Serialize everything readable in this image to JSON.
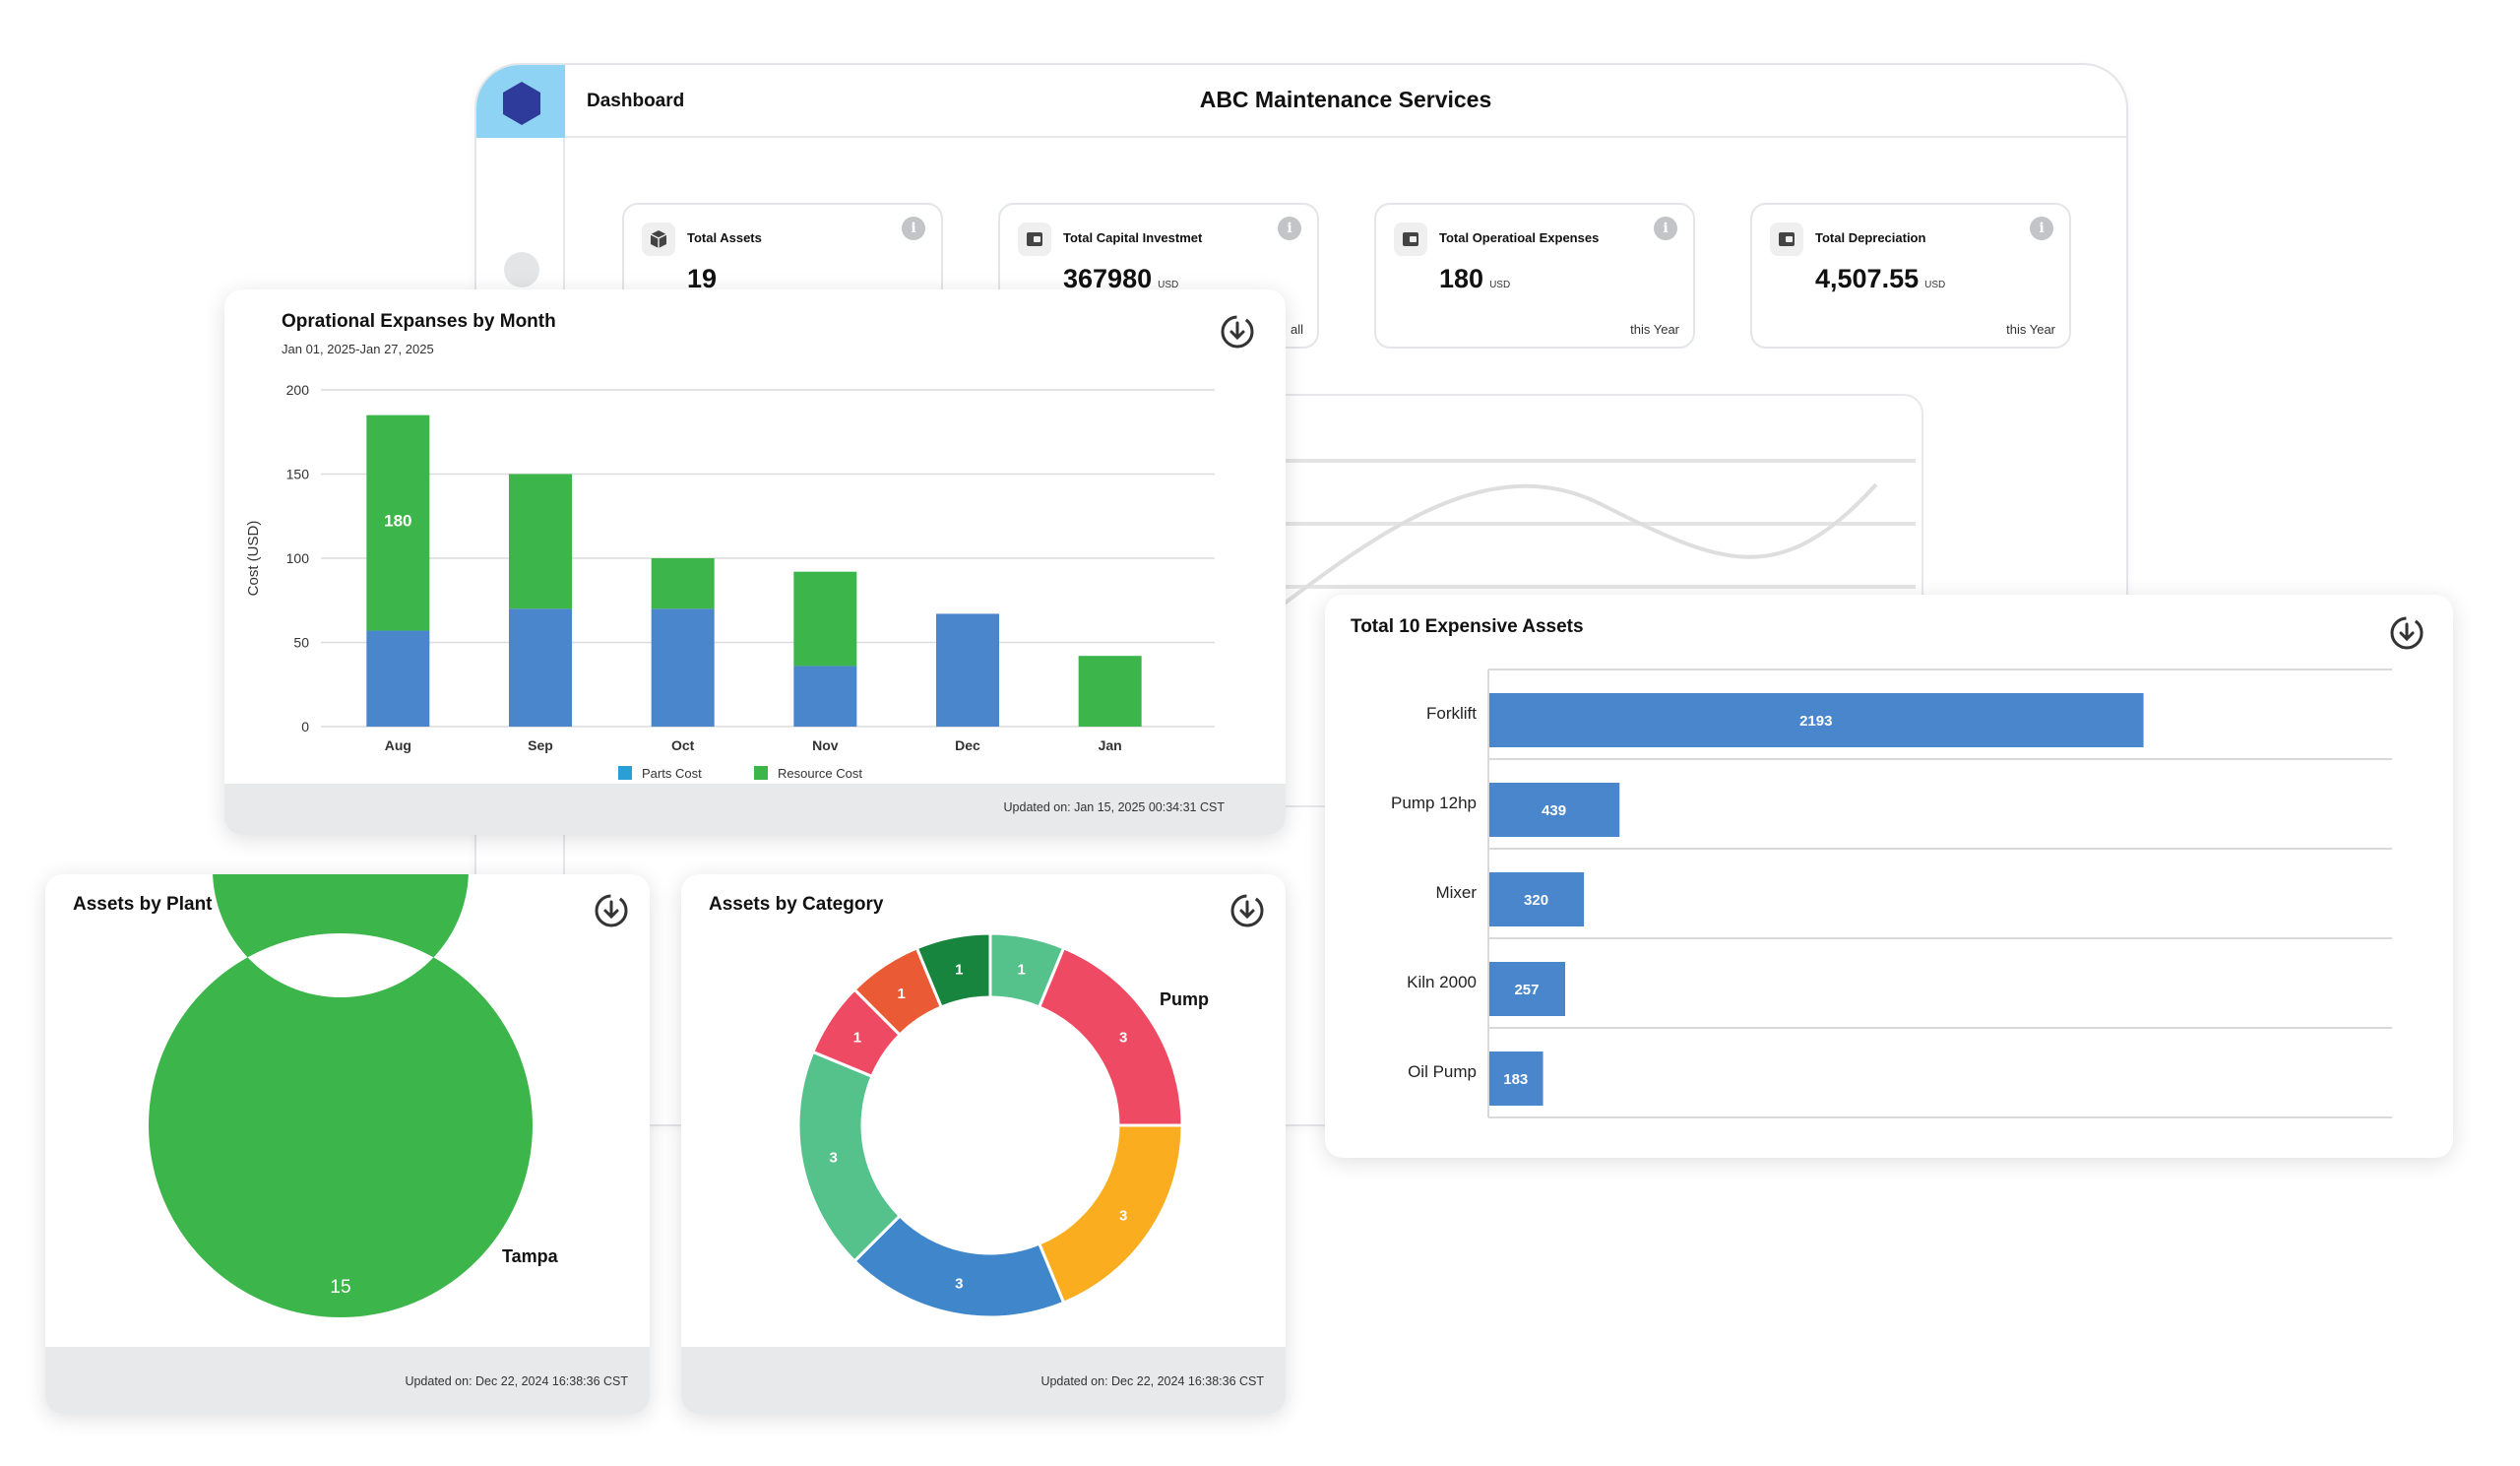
{
  "window": {
    "section": "Dashboard",
    "title": "ABC Maintenance Services",
    "logo_icon": "hexagon-logo-icon",
    "accent_color": "#8ed3f3"
  },
  "stats": [
    {
      "label": "Total Assets",
      "value": "19",
      "unit": "",
      "foot": "",
      "icon": "box-icon"
    },
    {
      "label": "Total Capital Investmet",
      "value": "367980",
      "unit": "USD",
      "foot": "all",
      "icon": "wallet-icon"
    },
    {
      "label": "Total Operatioal Expenses",
      "value": "180",
      "unit": "USD",
      "foot": "this Year",
      "icon": "wallet-icon"
    },
    {
      "label": "Total Depreciation",
      "value": "4,507.55",
      "unit": "USD",
      "foot": "this Year",
      "icon": "wallet-icon"
    }
  ],
  "opex_card": {
    "title": "Oprational Expanses by Month",
    "date_range": "Jan 01, 2025-Jan 27, 2025",
    "updated": "Updated on: Jan 15, 2025 00:34:31 CST"
  },
  "expensive_card": {
    "title": "Total 10 Expensive Assets"
  },
  "plant_card": {
    "title": "Assets by Plant or Facility",
    "updated": "Updated on: Dec 22, 2024 16:38:36 CST"
  },
  "category_card": {
    "title": "Assets by Category",
    "updated": "Updated on: Dec 22, 2024 16:38:36 CST"
  },
  "chart_data": [
    {
      "type": "bar",
      "stacked": true,
      "categories": [
        "Aug",
        "Sep",
        "Oct",
        "Nov",
        "Dec",
        "Jan"
      ],
      "series": [
        {
          "name": "Parts Cost",
          "values": [
            57,
            70,
            70,
            36,
            67,
            0
          ],
          "color": "#4a86cc",
          "legend_color": "#2a9fd6"
        },
        {
          "name": "Resource Cost",
          "values": [
            128,
            80,
            30,
            56,
            0,
            42
          ],
          "color": "#3cb54a"
        }
      ],
      "data_labels": [
        {
          "category": "Aug",
          "text": "180"
        }
      ],
      "ylabel": "Cost (USD)",
      "ylim": [
        0,
        200
      ],
      "yticks": [
        0,
        50,
        100,
        150,
        200
      ],
      "grid": true,
      "legend": "bottom"
    },
    {
      "type": "bar",
      "orientation": "horizontal",
      "categories": [
        "Forklift",
        "Pump 12hp",
        "Mixer",
        "Kiln 2000",
        "Oil Pump"
      ],
      "values": [
        2193,
        439,
        320,
        257,
        183
      ],
      "color": "#4a86cc",
      "grid": true
    },
    {
      "type": "pie",
      "donut": true,
      "slices": [
        {
          "label": "Tampa",
          "value": 15,
          "color": "#3cb54a"
        }
      ]
    },
    {
      "type": "pie",
      "donut": true,
      "slices": [
        {
          "label": "",
          "value": 1,
          "color": "#55c28c"
        },
        {
          "label": "Pump",
          "value": 3,
          "color": "#ef4a63"
        },
        {
          "label": "",
          "value": 3,
          "color": "#fbad20"
        },
        {
          "label": "",
          "value": 3,
          "color": "#3f86cb"
        },
        {
          "label": "",
          "value": 3,
          "color": "#55c28c"
        },
        {
          "label": "",
          "value": 1,
          "color": "#ef4a63"
        },
        {
          "label": "",
          "value": 1,
          "color": "#ea5a35"
        },
        {
          "label": "",
          "value": 1,
          "color": "#17853e"
        }
      ]
    }
  ]
}
